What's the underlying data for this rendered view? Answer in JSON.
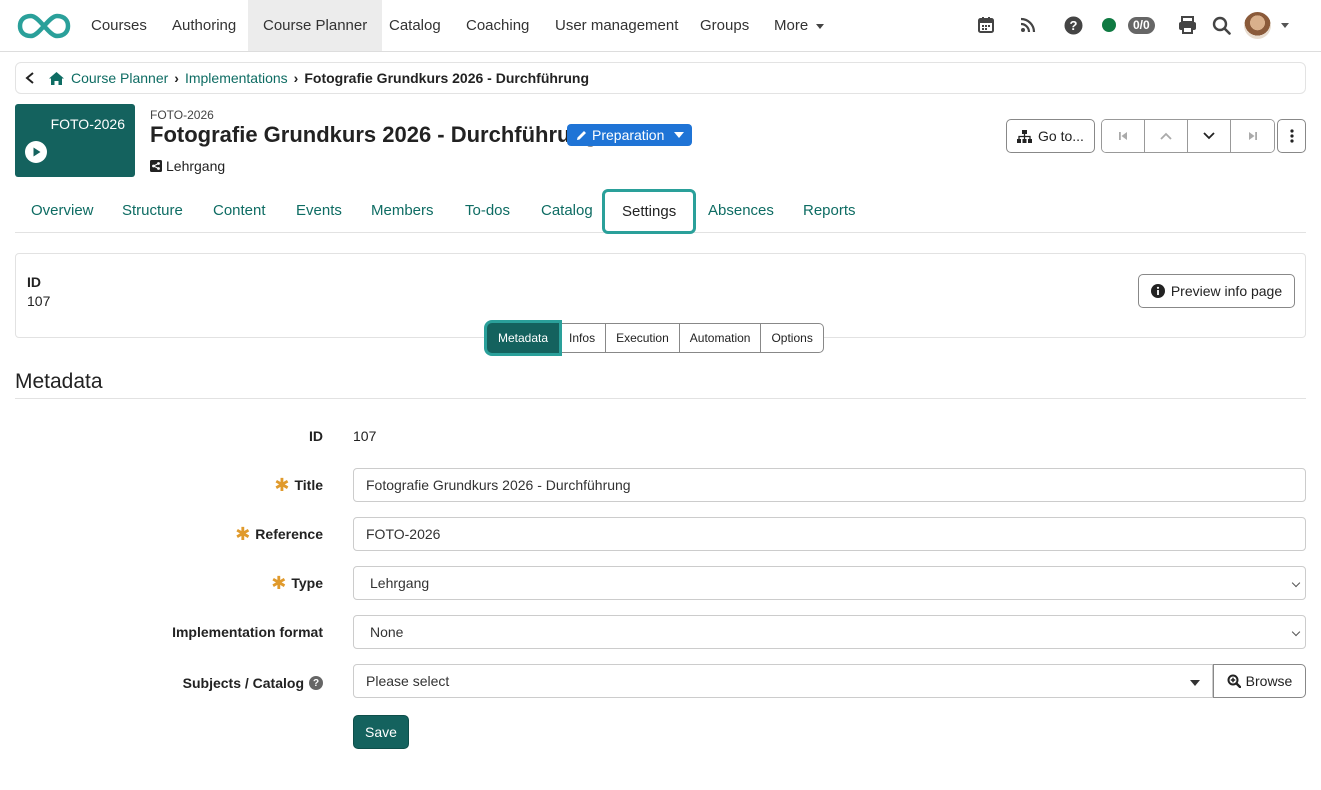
{
  "nav": {
    "items": [
      "Courses",
      "Authoring",
      "Course Planner",
      "Catalog",
      "Coaching",
      "User management",
      "Groups",
      "More"
    ],
    "active_index": 2,
    "status_count": "0/0",
    "icons": [
      "calendar-icon",
      "rss-icon",
      "help-icon",
      "print-icon",
      "search-icon"
    ]
  },
  "breadcrumb": {
    "items": [
      "Course Planner",
      "Implementations"
    ],
    "current": "Fotografie Grundkurs 2026 - Durchführung"
  },
  "header": {
    "thumb_label": "FOTO-2026",
    "ext_ref": "FOTO-2026",
    "title": "Fotografie Grundkurs 2026 - Durchführung",
    "status": "Preparation",
    "type": "Lehrgang",
    "goto_label": "Go to..."
  },
  "tabs": [
    "Overview",
    "Structure",
    "Content",
    "Events",
    "Members",
    "To-dos",
    "Catalog",
    "Settings",
    "Absences",
    "Reports"
  ],
  "active_tab": "Settings",
  "idbox": {
    "label": "ID",
    "value": "107",
    "preview_label": "Preview info page"
  },
  "subtabs": [
    "Metadata",
    "Infos",
    "Execution",
    "Automation",
    "Options"
  ],
  "section_title": "Metadata",
  "form": {
    "id_label": "ID",
    "id_value": "107",
    "title_label": "Title",
    "title_value": "Fotografie Grundkurs 2026 - Durchführung",
    "reference_label": "Reference",
    "reference_value": "FOTO-2026",
    "type_label": "Type",
    "type_value": "Lehrgang",
    "format_label": "Implementation format",
    "format_value": "None",
    "catalog_label": "Subjects / Catalog",
    "catalog_value": "Please select",
    "browse_label": "Browse",
    "save_label": "Save"
  },
  "colors": {
    "brand": "#14625e",
    "link": "#0e6c63",
    "status": "#1f74d6",
    "required": "#e09a2c",
    "focus": "#2aa09a"
  }
}
